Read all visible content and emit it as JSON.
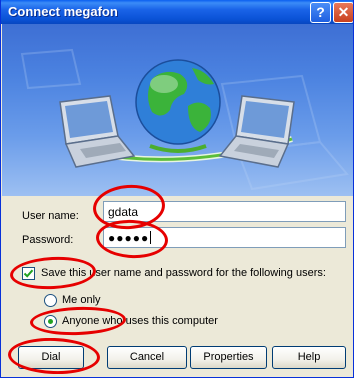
{
  "window": {
    "title": "Connect megafon",
    "help_glyph": "?",
    "close_glyph": "✕"
  },
  "form": {
    "username_label": "User name:",
    "username_value": "gdata",
    "password_label": "Password:",
    "password_value": "●●●●●",
    "save_checkbox_label": "Save this user name and password for the following users:",
    "save_checked": true,
    "radio_me_label": "Me only",
    "radio_anyone_label": "Anyone who uses this computer",
    "selected_option": "Anyone who uses this computer"
  },
  "buttons": {
    "dial": "Dial",
    "cancel": "Cancel",
    "properties": "Properties",
    "help": "Help"
  },
  "icons": {
    "banner": "network-globe-laptops-icon",
    "help": "help-icon",
    "close": "close-icon",
    "check": "check-icon"
  },
  "colors": {
    "titlebar": "#0A52D6",
    "annotation": "#E60000",
    "dialog_bg": "#ECE9D8"
  }
}
